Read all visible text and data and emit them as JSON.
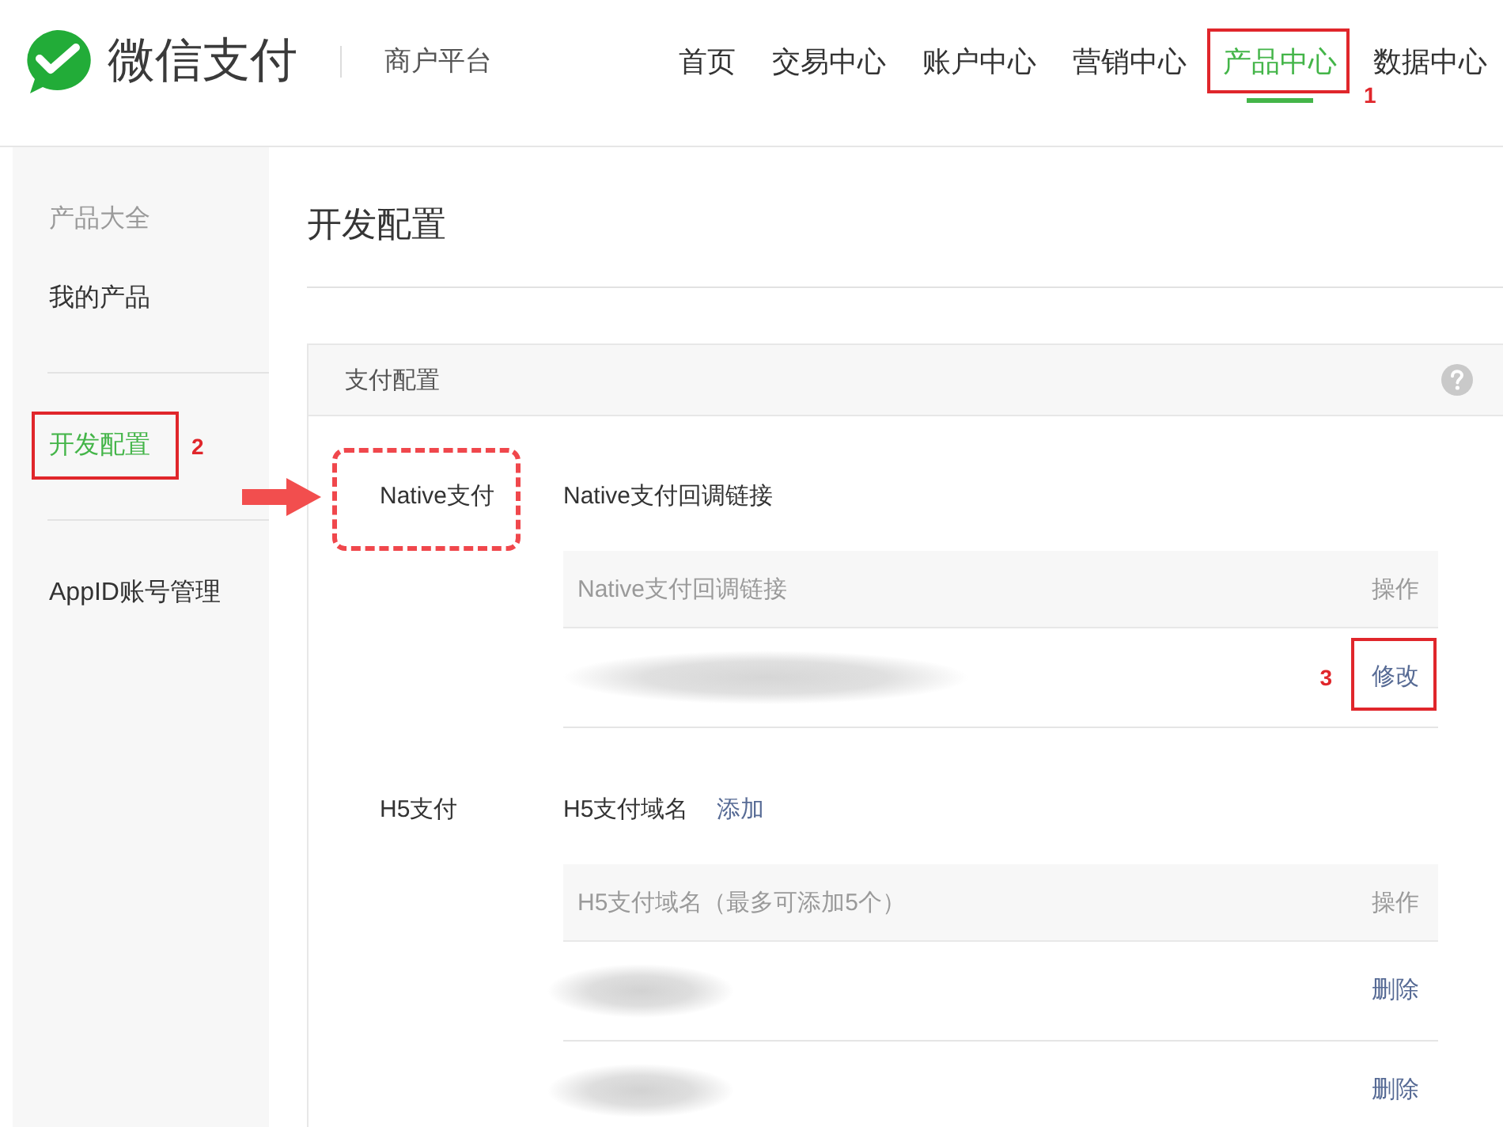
{
  "header": {
    "brand": "微信支付",
    "platform": "商户平台",
    "nav": [
      {
        "label": "首页",
        "selected": false
      },
      {
        "label": "交易中心",
        "selected": false
      },
      {
        "label": "账户中心",
        "selected": false
      },
      {
        "label": "营销中心",
        "selected": false
      },
      {
        "label": "产品中心",
        "selected": true,
        "callout": "1"
      },
      {
        "label": "数据中心",
        "selected": false
      }
    ]
  },
  "sidebar": {
    "groups": [
      {
        "items": [
          {
            "label": "产品大全",
            "kind": "secondary",
            "selected": false
          },
          {
            "label": "我的产品",
            "kind": "link",
            "selected": false
          }
        ]
      },
      {
        "items": [
          {
            "label": "开发配置",
            "kind": "link",
            "selected": true,
            "callout": "2"
          }
        ]
      },
      {
        "items": [
          {
            "label": "AppID账号管理",
            "kind": "link",
            "selected": false
          }
        ]
      }
    ]
  },
  "page_title": "开发配置",
  "panel": {
    "title": "支付配置",
    "sections": [
      {
        "label": "Native支付",
        "highlighted": true,
        "heading": "Native支付回调链接",
        "table": {
          "columns": [
            "Native支付回调链接",
            "操作"
          ],
          "rows": [
            {
              "action": "修改",
              "callout": "3"
            }
          ]
        }
      },
      {
        "label": "H5支付",
        "highlighted": false,
        "heading": "H5支付域名",
        "heading_link": "添加",
        "table": {
          "columns": [
            "H5支付域名（最多可添加5个）",
            "操作"
          ],
          "rows": [
            {
              "action": "删除"
            },
            {
              "action": "删除"
            }
          ]
        }
      }
    ]
  }
}
